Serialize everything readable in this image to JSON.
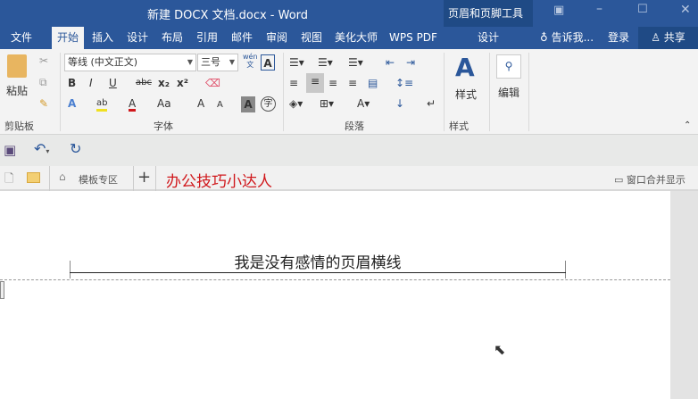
{
  "window": {
    "title": "新建 DOCX 文档.docx - Word",
    "context_group": "页眉和页脚工具",
    "icons": [
      "restore-ribbon-icon",
      "minimize-icon",
      "maximize-icon",
      "close-icon"
    ]
  },
  "tabs": [
    "文件",
    "开始",
    "插入",
    "设计",
    "布局",
    "引用",
    "邮件",
    "审阅",
    "视图",
    "美化大师",
    "WPS PDF"
  ],
  "context_tab": "设计",
  "tell_me": "告诉我...",
  "login": "登录",
  "share": "共享",
  "ribbon": {
    "clipboard": {
      "paste": "粘贴",
      "label": "剪贴板"
    },
    "font": {
      "font_name": "等线 (中文正文)",
      "font_size": "三号",
      "phonetic": "wén\n文",
      "bold": "B",
      "italic": "I",
      "underline": "U",
      "strike": "abc",
      "sub": "x₂",
      "sup": "x²",
      "label": "字体",
      "grow": "A",
      "shrink": "A",
      "case": "Aa",
      "char_shade": "A",
      "enclose": "字"
    },
    "paragraph": {
      "label": "段落"
    },
    "styles": {
      "button": "样式",
      "label": "样式"
    },
    "editing": {
      "button": "编辑"
    }
  },
  "tabbar": {
    "template": "模板专区",
    "add": "+",
    "brand": "办公技巧小达人",
    "merge": "窗口合并显示"
  },
  "document": {
    "header_text": "我是没有感情的页眉横线"
  },
  "colors": {
    "accent": "#2b579a",
    "brand": "#d0171b"
  }
}
